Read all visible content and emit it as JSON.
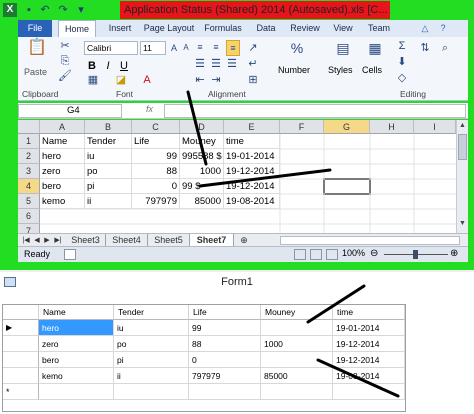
{
  "excel": {
    "title": "Application Status (Shared) 2014 (Autosaved).xls  [C...",
    "ribbon_tabs": [
      "File",
      "Home",
      "Insert",
      "Page Layout",
      "Formulas",
      "Data",
      "Review",
      "View",
      "Team"
    ],
    "clipboard": {
      "paste_label": "Paste",
      "group_label": "Clipboard"
    },
    "font": {
      "family": "Calibri",
      "size": "11",
      "group_label": "Font"
    },
    "alignment": {
      "group_label": "Alignment"
    },
    "number": {
      "label": "Number"
    },
    "styles": {
      "label": "Styles"
    },
    "cells": {
      "label": "Cells"
    },
    "editing": {
      "group_label": "Editing"
    },
    "name_box": "G4",
    "fx_label": "fx",
    "columns": [
      "A",
      "B",
      "C",
      "D",
      "E",
      "F",
      "G",
      "H",
      "I"
    ],
    "rows": [
      {
        "num": "1",
        "cells": [
          "Name",
          "Tender",
          "Life",
          "Mouney",
          "time"
        ]
      },
      {
        "num": "2",
        "cells": [
          "hero",
          "iu",
          "99",
          "995588 $",
          "19-01-2014"
        ]
      },
      {
        "num": "3",
        "cells": [
          "zero",
          "po",
          "88",
          "1000",
          "19-12-2014"
        ]
      },
      {
        "num": "4",
        "cells": [
          "bero",
          "pi",
          "0",
          "99 $",
          "19-12-2014"
        ]
      },
      {
        "num": "5",
        "cells": [
          "kemo",
          "ii",
          "797979",
          "85000",
          "19-08-2014"
        ]
      },
      {
        "num": "6",
        "cells": [
          "",
          "",
          "",
          "",
          ""
        ]
      },
      {
        "num": "7",
        "cells": [
          "",
          "",
          "",
          "",
          ""
        ]
      }
    ],
    "sheet_tabs": [
      "Sheet3",
      "Sheet4",
      "Sheet5",
      "Sheet7"
    ],
    "active_sheet": "Sheet7",
    "status": "Ready",
    "zoom": "100%"
  },
  "form": {
    "title": "Form1",
    "columns": [
      "Name",
      "Tender",
      "Life",
      "Mouney",
      "time"
    ],
    "rows": [
      [
        "hero",
        "iu",
        "99",
        "",
        "19-01-2014"
      ],
      [
        "zero",
        "po",
        "88",
        "1000",
        "19-12-2014"
      ],
      [
        "bero",
        "pi",
        "0",
        "",
        "19-12-2014"
      ],
      [
        "kemo",
        "ii",
        "797979",
        "85000",
        "19-08-2014"
      ]
    ],
    "new_row_marker": "*",
    "current_row_marker": "▶"
  }
}
